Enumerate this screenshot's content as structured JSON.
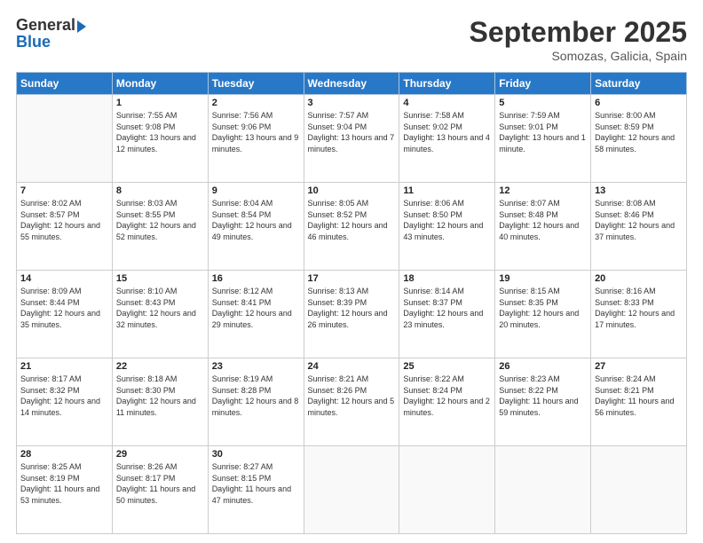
{
  "logo": {
    "general": "General",
    "blue": "Blue"
  },
  "header": {
    "month": "September 2025",
    "location": "Somozas, Galicia, Spain"
  },
  "weekdays": [
    "Sunday",
    "Monday",
    "Tuesday",
    "Wednesday",
    "Thursday",
    "Friday",
    "Saturday"
  ],
  "weeks": [
    [
      {
        "day": "",
        "sunrise": "",
        "sunset": "",
        "daylight": ""
      },
      {
        "day": "1",
        "sunrise": "Sunrise: 7:55 AM",
        "sunset": "Sunset: 9:08 PM",
        "daylight": "Daylight: 13 hours and 12 minutes."
      },
      {
        "day": "2",
        "sunrise": "Sunrise: 7:56 AM",
        "sunset": "Sunset: 9:06 PM",
        "daylight": "Daylight: 13 hours and 9 minutes."
      },
      {
        "day": "3",
        "sunrise": "Sunrise: 7:57 AM",
        "sunset": "Sunset: 9:04 PM",
        "daylight": "Daylight: 13 hours and 7 minutes."
      },
      {
        "day": "4",
        "sunrise": "Sunrise: 7:58 AM",
        "sunset": "Sunset: 9:02 PM",
        "daylight": "Daylight: 13 hours and 4 minutes."
      },
      {
        "day": "5",
        "sunrise": "Sunrise: 7:59 AM",
        "sunset": "Sunset: 9:01 PM",
        "daylight": "Daylight: 13 hours and 1 minute."
      },
      {
        "day": "6",
        "sunrise": "Sunrise: 8:00 AM",
        "sunset": "Sunset: 8:59 PM",
        "daylight": "Daylight: 12 hours and 58 minutes."
      }
    ],
    [
      {
        "day": "7",
        "sunrise": "Sunrise: 8:02 AM",
        "sunset": "Sunset: 8:57 PM",
        "daylight": "Daylight: 12 hours and 55 minutes."
      },
      {
        "day": "8",
        "sunrise": "Sunrise: 8:03 AM",
        "sunset": "Sunset: 8:55 PM",
        "daylight": "Daylight: 12 hours and 52 minutes."
      },
      {
        "day": "9",
        "sunrise": "Sunrise: 8:04 AM",
        "sunset": "Sunset: 8:54 PM",
        "daylight": "Daylight: 12 hours and 49 minutes."
      },
      {
        "day": "10",
        "sunrise": "Sunrise: 8:05 AM",
        "sunset": "Sunset: 8:52 PM",
        "daylight": "Daylight: 12 hours and 46 minutes."
      },
      {
        "day": "11",
        "sunrise": "Sunrise: 8:06 AM",
        "sunset": "Sunset: 8:50 PM",
        "daylight": "Daylight: 12 hours and 43 minutes."
      },
      {
        "day": "12",
        "sunrise": "Sunrise: 8:07 AM",
        "sunset": "Sunset: 8:48 PM",
        "daylight": "Daylight: 12 hours and 40 minutes."
      },
      {
        "day": "13",
        "sunrise": "Sunrise: 8:08 AM",
        "sunset": "Sunset: 8:46 PM",
        "daylight": "Daylight: 12 hours and 37 minutes."
      }
    ],
    [
      {
        "day": "14",
        "sunrise": "Sunrise: 8:09 AM",
        "sunset": "Sunset: 8:44 PM",
        "daylight": "Daylight: 12 hours and 35 minutes."
      },
      {
        "day": "15",
        "sunrise": "Sunrise: 8:10 AM",
        "sunset": "Sunset: 8:43 PM",
        "daylight": "Daylight: 12 hours and 32 minutes."
      },
      {
        "day": "16",
        "sunrise": "Sunrise: 8:12 AM",
        "sunset": "Sunset: 8:41 PM",
        "daylight": "Daylight: 12 hours and 29 minutes."
      },
      {
        "day": "17",
        "sunrise": "Sunrise: 8:13 AM",
        "sunset": "Sunset: 8:39 PM",
        "daylight": "Daylight: 12 hours and 26 minutes."
      },
      {
        "day": "18",
        "sunrise": "Sunrise: 8:14 AM",
        "sunset": "Sunset: 8:37 PM",
        "daylight": "Daylight: 12 hours and 23 minutes."
      },
      {
        "day": "19",
        "sunrise": "Sunrise: 8:15 AM",
        "sunset": "Sunset: 8:35 PM",
        "daylight": "Daylight: 12 hours and 20 minutes."
      },
      {
        "day": "20",
        "sunrise": "Sunrise: 8:16 AM",
        "sunset": "Sunset: 8:33 PM",
        "daylight": "Daylight: 12 hours and 17 minutes."
      }
    ],
    [
      {
        "day": "21",
        "sunrise": "Sunrise: 8:17 AM",
        "sunset": "Sunset: 8:32 PM",
        "daylight": "Daylight: 12 hours and 14 minutes."
      },
      {
        "day": "22",
        "sunrise": "Sunrise: 8:18 AM",
        "sunset": "Sunset: 8:30 PM",
        "daylight": "Daylight: 12 hours and 11 minutes."
      },
      {
        "day": "23",
        "sunrise": "Sunrise: 8:19 AM",
        "sunset": "Sunset: 8:28 PM",
        "daylight": "Daylight: 12 hours and 8 minutes."
      },
      {
        "day": "24",
        "sunrise": "Sunrise: 8:21 AM",
        "sunset": "Sunset: 8:26 PM",
        "daylight": "Daylight: 12 hours and 5 minutes."
      },
      {
        "day": "25",
        "sunrise": "Sunrise: 8:22 AM",
        "sunset": "Sunset: 8:24 PM",
        "daylight": "Daylight: 12 hours and 2 minutes."
      },
      {
        "day": "26",
        "sunrise": "Sunrise: 8:23 AM",
        "sunset": "Sunset: 8:22 PM",
        "daylight": "Daylight: 11 hours and 59 minutes."
      },
      {
        "day": "27",
        "sunrise": "Sunrise: 8:24 AM",
        "sunset": "Sunset: 8:21 PM",
        "daylight": "Daylight: 11 hours and 56 minutes."
      }
    ],
    [
      {
        "day": "28",
        "sunrise": "Sunrise: 8:25 AM",
        "sunset": "Sunset: 8:19 PM",
        "daylight": "Daylight: 11 hours and 53 minutes."
      },
      {
        "day": "29",
        "sunrise": "Sunrise: 8:26 AM",
        "sunset": "Sunset: 8:17 PM",
        "daylight": "Daylight: 11 hours and 50 minutes."
      },
      {
        "day": "30",
        "sunrise": "Sunrise: 8:27 AM",
        "sunset": "Sunset: 8:15 PM",
        "daylight": "Daylight: 11 hours and 47 minutes."
      },
      {
        "day": "",
        "sunrise": "",
        "sunset": "",
        "daylight": ""
      },
      {
        "day": "",
        "sunrise": "",
        "sunset": "",
        "daylight": ""
      },
      {
        "day": "",
        "sunrise": "",
        "sunset": "",
        "daylight": ""
      },
      {
        "day": "",
        "sunrise": "",
        "sunset": "",
        "daylight": ""
      }
    ]
  ]
}
